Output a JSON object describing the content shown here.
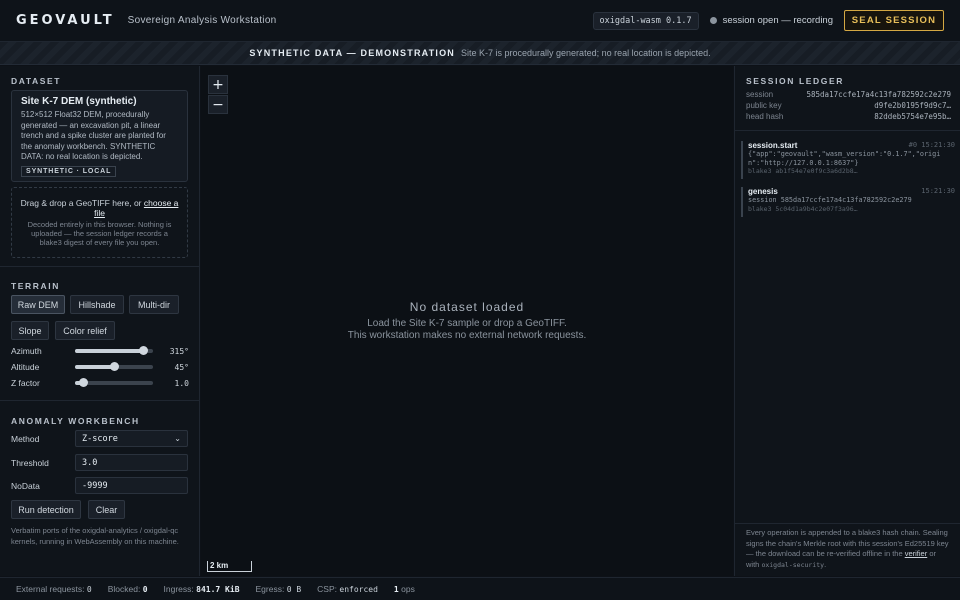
{
  "header": {
    "logo": "GEOVAULT",
    "subtitle": "Sovereign Analysis Workstation",
    "version": "oxigdal-wasm 0.1.7",
    "session_status": "session open — recording",
    "seal_button": "SEAL SESSION"
  },
  "banner": {
    "strong": "SYNTHETIC DATA — DEMONSTRATION",
    "text": "Site K-7 is procedurally generated; no real location is depicted."
  },
  "dataset": {
    "section": "DATASET",
    "card_title": "Site K-7 DEM (synthetic)",
    "card_desc": "512×512 Float32 DEM, procedurally generated — an excavation pit, a linear trench and a spike cluster are planted for the anomaly workbench. SYNTHETIC DATA: no real location is depicted.",
    "card_tag": "SYNTHETIC · LOCAL",
    "drop_text": "Drag & drop a GeoTIFF here, or",
    "drop_link": "choose a file",
    "drop_sub": "Decoded entirely in this browser. Nothing is uploaded — the session ledger records a blake3 digest of every file you open."
  },
  "terrain": {
    "section": "TERRAIN",
    "modes": [
      "Raw DEM",
      "Hillshade",
      "Multi-dir",
      "Slope",
      "Color relief"
    ],
    "active_mode": "Raw DEM",
    "sliders": [
      {
        "label": "Azimuth",
        "value": "315°",
        "fraction": 0.875
      },
      {
        "label": "Altitude",
        "value": "45°",
        "fraction": 0.5
      },
      {
        "label": "Z factor",
        "value": "1.0",
        "fraction": 0.1
      }
    ]
  },
  "workbench": {
    "section": "ANOMALY WORKBENCH",
    "method_label": "Method",
    "method_value": "Z-score",
    "threshold_label": "Threshold",
    "threshold_value": "3.0",
    "nodata_label": "NoData",
    "nodata_value": "-9999",
    "run_button": "Run detection",
    "clear_button": "Clear",
    "note": "Verbatim ports of the oxigdal-analytics / oxigdal-qc kernels, running in WebAssembly on this machine."
  },
  "map": {
    "zoom_in": "+",
    "zoom_out": "−",
    "empty_title": "No dataset loaded",
    "empty_line1": "Load the Site K-7 sample or drop a GeoTIFF.",
    "empty_line2": "This workstation makes no external network requests.",
    "scale": "2 km"
  },
  "ledger": {
    "section": "SESSION LEDGER",
    "session_label": "session",
    "session_value": "585da17ccfe17a4c13fa782592c2e279",
    "pubkey_label": "public key",
    "pubkey_value": "d9fe2b0195f9d9c7…",
    "head_label": "head hash",
    "head_value": "82ddeb5754e7e95b…",
    "entries": [
      {
        "op": "session.start",
        "time": "#0   15:21:30",
        "body": "{\"app\":\"geovault\",\"wasm_version\":\"0.1.7\",\"origin\":\"http://127.0.0.1:8637\"}",
        "hash": "blake3 ab1f54e7e0f9c3a6d2b8…"
      },
      {
        "op": "genesis",
        "time": "15:21:30",
        "body": "session 585da17ccfe17a4c13fa782592c2e279",
        "hash": "blake3 5c04d1a9b4c2e07f3a96…"
      }
    ],
    "note_text": "Every operation is appended to a blake3 hash chain. Sealing signs the chain's Merkle root with this session's Ed25519 key — the download can be re-verified offline in the",
    "note_link": "verifier",
    "note_mid": "or with",
    "note_mono": "oxigdal-security",
    "note_end": "."
  },
  "footer": {
    "external_label": "External requests:",
    "external_value": "0",
    "blocked_label": "Blocked:",
    "blocked_value": "0",
    "ingress_label": "Ingress:",
    "ingress_value": "841.7 KiB",
    "egress_label": "Egress:",
    "egress_value": "0 B",
    "csp_label": "CSP:",
    "csp_value": "enforced",
    "ops_value": "1",
    "ops_label": "ops"
  }
}
